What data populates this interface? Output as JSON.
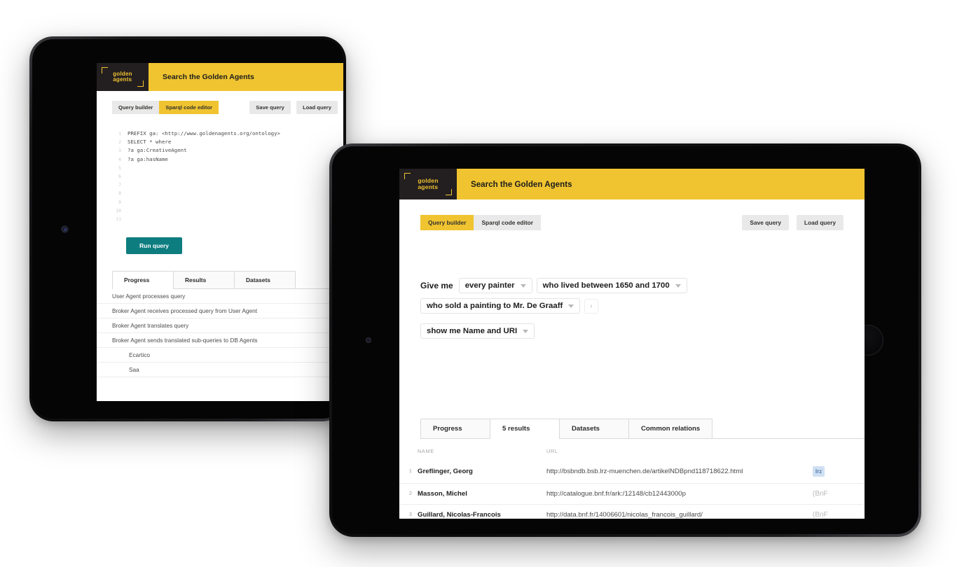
{
  "brand": {
    "logo_line1": "golden",
    "logo_line2": "agents",
    "yellow": "#F0C430",
    "dark": "#231f20",
    "teal": "#0E7D80"
  },
  "back_tablet": {
    "header_title": "Search the Golden Agents",
    "tabs": [
      {
        "label": "Query builder",
        "active": false
      },
      {
        "label": "Sparql code editor",
        "active": true
      }
    ],
    "actions": [
      {
        "label": "Save query"
      },
      {
        "label": "Load query"
      }
    ],
    "editor": {
      "lines": [
        {
          "n": "1",
          "text": "PREFIX ga: <http://www.goldenagents.org/ontology>"
        },
        {
          "n": "2",
          "text": "SELECT * where"
        },
        {
          "n": "3",
          "text": "?a ga:CreativeAgent"
        },
        {
          "n": "4",
          "text": "?a ga:hasName"
        },
        {
          "n": "5",
          "text": ""
        },
        {
          "n": "6",
          "text": ""
        },
        {
          "n": "7",
          "text": ""
        },
        {
          "n": "8",
          "text": ""
        },
        {
          "n": "9",
          "text": ""
        },
        {
          "n": "10",
          "text": ""
        },
        {
          "n": "11",
          "text": ""
        }
      ]
    },
    "run_button": "Run query",
    "result_tabs": [
      {
        "label": "Progress",
        "active": true
      },
      {
        "label": "Results",
        "active": false
      },
      {
        "label": "Datasets",
        "active": false
      }
    ],
    "progress_rows": [
      {
        "text": "User Agent processes query",
        "indent": false
      },
      {
        "text": "Broker Agent receives processed query from User Agent",
        "indent": false
      },
      {
        "text": "Broker Agent translates query",
        "indent": false
      },
      {
        "text": "Broker Agent sends translated sub-queries to DB Agents",
        "indent": false
      },
      {
        "text": "Ecartico",
        "indent": true
      },
      {
        "text": "Saa",
        "indent": true
      }
    ]
  },
  "front_tablet": {
    "header_title": "Search the Golden Agents",
    "tabs": [
      {
        "label": "Query builder",
        "active": true
      },
      {
        "label": "Sparql code editor",
        "active": false
      }
    ],
    "actions": [
      {
        "label": "Save query"
      },
      {
        "label": "Load query"
      }
    ],
    "builder": {
      "lead": "Give me",
      "chips": [
        {
          "label": "every painter"
        },
        {
          "label": "who lived between 1650 and 1700"
        },
        {
          "label": "who sold a painting to Mr. De Graaff"
        }
      ],
      "next_arrow": "›",
      "output_chip": {
        "label": "show me Name and URI"
      }
    },
    "result_tabs": [
      {
        "label": "Progress",
        "active": false
      },
      {
        "label": "5 results",
        "active": true
      },
      {
        "label": "Datasets",
        "active": false
      },
      {
        "label": "Common relations",
        "active": false
      }
    ],
    "results_table": {
      "columns": [
        "NAME",
        "URL"
      ],
      "rows": [
        {
          "index": "1",
          "name": "Greflinger, Georg",
          "url": "http://bsbndb.bsb.lrz-muenchen.de/artikelNDBpnd118718622.html",
          "source_badge": "lrz",
          "source_text": ""
        },
        {
          "index": "2",
          "name": "Masson, Michel",
          "url": "http://catalogue.bnf.fr/ark:/12148/cb12443000p",
          "source_badge": "",
          "source_text": "(BnF"
        },
        {
          "index": "3",
          "name": "Guillard, Nicolas-Francois",
          "url": "http://data.bnf.fr/14006601/nicolas_francois_guillard/",
          "source_badge": "",
          "source_text": "(BnF"
        }
      ]
    }
  }
}
